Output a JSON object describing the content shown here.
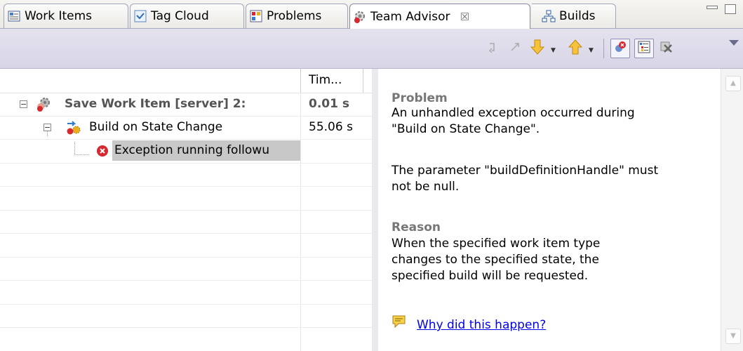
{
  "tabs": [
    {
      "label": "Work Items",
      "icon": "work-items-icon"
    },
    {
      "label": "Tag Cloud",
      "icon": "tag-cloud-icon"
    },
    {
      "label": "Problems",
      "icon": "problems-icon"
    },
    {
      "label": "Team Advisor",
      "icon": "team-advisor-icon",
      "active": true,
      "close": "☒"
    },
    {
      "label": "Builds",
      "icon": "builds-icon"
    }
  ],
  "table": {
    "columns": [
      "",
      "Tim..."
    ],
    "rows": [
      {
        "name": "Save Work Item [server] 2:",
        "time": "0.01 s",
        "level": 0
      },
      {
        "name": "Build on State Change",
        "time": "55.06 s",
        "level": 1
      },
      {
        "name": "Exception running followu",
        "time": "",
        "level": 2
      }
    ]
  },
  "detail": {
    "problem_heading": "Problem",
    "problem_text_1": "An unhandled exception occurred during",
    "problem_text_2": "\"Build on State Change\".",
    "problem_text_3": "The parameter \"buildDefinitionHandle\" must",
    "problem_text_4": "not be null.",
    "reason_heading": "Reason",
    "reason_text_1": "When the specified work item type",
    "reason_text_2": "changes to the specified state, the",
    "reason_text_3": "specified build will be requested.",
    "link_label": "Why did this happen?"
  },
  "colors": {
    "accent": "#0000ee",
    "error": "#d8282f",
    "selection": "#c8c8c8",
    "toolbar": "#dcd9ea"
  }
}
